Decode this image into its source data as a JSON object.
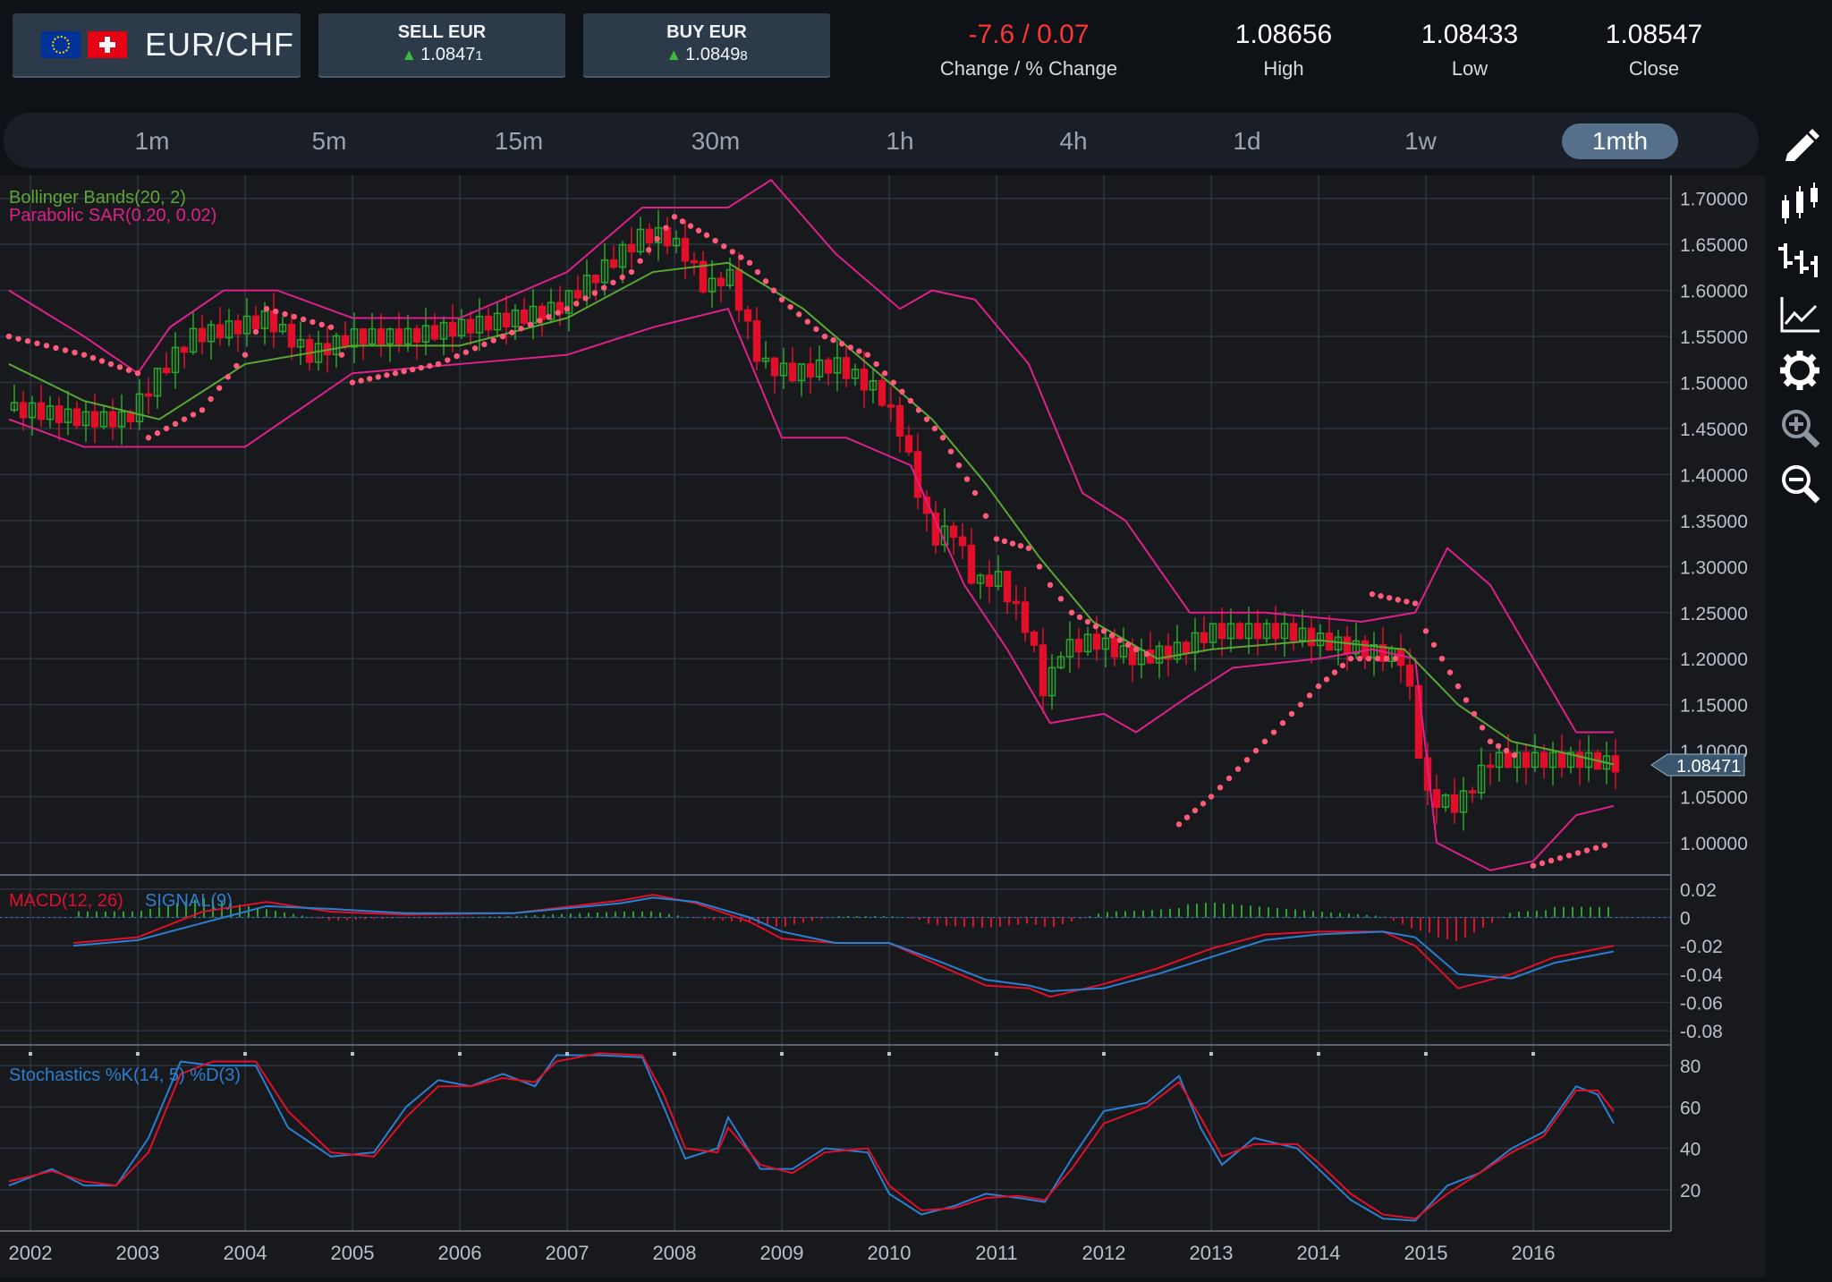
{
  "header": {
    "pair": "EUR/CHF",
    "base_flag": "eu-flag",
    "quote_flag": "ch-flag",
    "sell": {
      "label": "SELL EUR",
      "price_main": "1.0847",
      "price_small": "1"
    },
    "buy": {
      "label": "BUY EUR",
      "price_main": "1.0849",
      "price_small": "8"
    },
    "change": {
      "value": "-7.6 / 0.07",
      "label": "Change / % Change"
    },
    "high": {
      "value": "1.08656",
      "label": "High"
    },
    "low": {
      "value": "1.08433",
      "label": "Low"
    },
    "close": {
      "value": "1.08547",
      "label": "Close"
    }
  },
  "timeframes": [
    "1m",
    "5m",
    "15m",
    "30m",
    "1h",
    "4h",
    "1d",
    "1w",
    "1mth"
  ],
  "active_timeframe": "1mth",
  "side_tools": [
    "pencil-icon",
    "candlestick-icon",
    "ohlc-bar-icon",
    "line-chart-icon",
    "settings-icon",
    "zoom-in-icon",
    "zoom-out-icon"
  ],
  "colors": {
    "up": "#28a628",
    "down": "#e0102a",
    "bollinger_mid": "#5aa832",
    "bollinger_band": "#e0208a",
    "sar": "#ff5a7a",
    "macd": "#e0102a",
    "signal": "#2a7fd0",
    "accent": "#56708c"
  },
  "indicators": {
    "bollinger": "Bollinger Bands(20, 2)",
    "sar": "Parabolic SAR(0.20, 0.02)",
    "macd": "MACD(12, 26)",
    "signal": "SIGNAL(9)",
    "stoch": "Stochastics %K(14, 5) %D(3)"
  },
  "last_price_tag": "1.08471",
  "chart_data": {
    "type": "candlestick",
    "price_axis": {
      "ylim": [
        0.965,
        1.725
      ],
      "ticks": [
        "1.70000",
        "1.65000",
        "1.60000",
        "1.55000",
        "1.50000",
        "1.45000",
        "1.40000",
        "1.35000",
        "1.30000",
        "1.25000",
        "1.20000",
        "1.15000",
        "1.10000",
        "1.05000",
        "1.00000"
      ]
    },
    "macd_axis": {
      "ylim": [
        -0.09,
        0.03
      ],
      "ticks": [
        "0.02",
        "0",
        "-0.02",
        "-0.04",
        "-0.06",
        "-0.08"
      ]
    },
    "stoch_axis": {
      "ylim": [
        0,
        90
      ],
      "ticks": [
        "80",
        "60",
        "40",
        "20"
      ]
    },
    "x_years": [
      "2002",
      "2003",
      "2004",
      "2005",
      "2006",
      "2007",
      "2008",
      "2009",
      "2010",
      "2011",
      "2012",
      "2013",
      "2014",
      "2015",
      "2016"
    ],
    "close_points": [
      [
        2001.8,
        1.47
      ],
      [
        2002.0,
        1.47
      ],
      [
        2002.5,
        1.46
      ],
      [
        2002.9,
        1.46
      ],
      [
        2003.2,
        1.51
      ],
      [
        2003.5,
        1.55
      ],
      [
        2003.9,
        1.56
      ],
      [
        2004.2,
        1.57
      ],
      [
        2004.6,
        1.53
      ],
      [
        2005.0,
        1.55
      ],
      [
        2005.5,
        1.55
      ],
      [
        2006.0,
        1.56
      ],
      [
        2006.5,
        1.57
      ],
      [
        2006.9,
        1.58
      ],
      [
        2007.3,
        1.62
      ],
      [
        2007.7,
        1.66
      ],
      [
        2007.9,
        1.66
      ],
      [
        2008.1,
        1.64
      ],
      [
        2008.3,
        1.6
      ],
      [
        2008.5,
        1.62
      ],
      [
        2008.8,
        1.52
      ],
      [
        2009.1,
        1.51
      ],
      [
        2009.5,
        1.52
      ],
      [
        2009.9,
        1.49
      ],
      [
        2010.1,
        1.45
      ],
      [
        2010.4,
        1.33
      ],
      [
        2010.6,
        1.34
      ],
      [
        2010.8,
        1.28
      ],
      [
        2011.0,
        1.29
      ],
      [
        2011.3,
        1.23
      ],
      [
        2011.45,
        1.16
      ],
      [
        2011.6,
        1.21
      ],
      [
        2011.9,
        1.22
      ],
      [
        2012.3,
        1.2
      ],
      [
        2012.7,
        1.21
      ],
      [
        2013.0,
        1.23
      ],
      [
        2013.3,
        1.23
      ],
      [
        2013.7,
        1.23
      ],
      [
        2014.0,
        1.22
      ],
      [
        2014.4,
        1.21
      ],
      [
        2014.8,
        1.2
      ],
      [
        2015.0,
        1.05
      ],
      [
        2015.3,
        1.04
      ],
      [
        2015.6,
        1.09
      ],
      [
        2015.9,
        1.09
      ],
      [
        2016.2,
        1.09
      ],
      [
        2016.5,
        1.09
      ],
      [
        2016.75,
        1.085
      ]
    ],
    "bollinger": {
      "upper": [
        [
          2001.8,
          1.6
        ],
        [
          2002.5,
          1.55
        ],
        [
          2003.0,
          1.51
        ],
        [
          2003.3,
          1.56
        ],
        [
          2003.8,
          1.6
        ],
        [
          2004.3,
          1.6
        ],
        [
          2005.0,
          1.57
        ],
        [
          2006.0,
          1.57
        ],
        [
          2007.0,
          1.62
        ],
        [
          2007.7,
          1.69
        ],
        [
          2008.5,
          1.69
        ],
        [
          2008.9,
          1.72
        ],
        [
          2009.5,
          1.64
        ],
        [
          2010.1,
          1.58
        ],
        [
          2010.4,
          1.6
        ],
        [
          2010.8,
          1.59
        ],
        [
          2011.3,
          1.52
        ],
        [
          2011.8,
          1.38
        ],
        [
          2012.2,
          1.35
        ],
        [
          2012.8,
          1.25
        ],
        [
          2013.5,
          1.25
        ],
        [
          2014.4,
          1.24
        ],
        [
          2014.9,
          1.25
        ],
        [
          2015.2,
          1.32
        ],
        [
          2015.6,
          1.28
        ],
        [
          2016.0,
          1.2
        ],
        [
          2016.4,
          1.12
        ],
        [
          2016.75,
          1.12
        ]
      ],
      "middle": [
        [
          2001.8,
          1.52
        ],
        [
          2002.5,
          1.48
        ],
        [
          2003.2,
          1.46
        ],
        [
          2004.0,
          1.52
        ],
        [
          2005.0,
          1.54
        ],
        [
          2006.0,
          1.54
        ],
        [
          2007.0,
          1.57
        ],
        [
          2007.8,
          1.62
        ],
        [
          2008.5,
          1.63
        ],
        [
          2009.2,
          1.58
        ],
        [
          2009.9,
          1.51
        ],
        [
          2010.4,
          1.46
        ],
        [
          2010.9,
          1.39
        ],
        [
          2011.4,
          1.31
        ],
        [
          2011.9,
          1.24
        ],
        [
          2012.5,
          1.2
        ],
        [
          2013.0,
          1.21
        ],
        [
          2014.0,
          1.22
        ],
        [
          2014.8,
          1.21
        ],
        [
          2015.3,
          1.15
        ],
        [
          2015.8,
          1.11
        ],
        [
          2016.2,
          1.1
        ],
        [
          2016.75,
          1.085
        ]
      ],
      "lower": [
        [
          2001.8,
          1.46
        ],
        [
          2002.5,
          1.43
        ],
        [
          2003.3,
          1.43
        ],
        [
          2004.0,
          1.43
        ],
        [
          2004.5,
          1.47
        ],
        [
          2005.0,
          1.51
        ],
        [
          2006.0,
          1.52
        ],
        [
          2007.0,
          1.53
        ],
        [
          2007.8,
          1.56
        ],
        [
          2008.5,
          1.58
        ],
        [
          2009.0,
          1.44
        ],
        [
          2009.6,
          1.44
        ],
        [
          2010.2,
          1.41
        ],
        [
          2010.7,
          1.28
        ],
        [
          2011.1,
          1.21
        ],
        [
          2011.5,
          1.13
        ],
        [
          2012.0,
          1.14
        ],
        [
          2012.3,
          1.12
        ],
        [
          2012.8,
          1.16
        ],
        [
          2013.2,
          1.19
        ],
        [
          2014.0,
          1.2
        ],
        [
          2014.5,
          1.21
        ],
        [
          2014.9,
          1.2
        ],
        [
          2015.1,
          1.0
        ],
        [
          2015.6,
          0.97
        ],
        [
          2016.0,
          0.98
        ],
        [
          2016.4,
          1.03
        ],
        [
          2016.75,
          1.04
        ]
      ]
    },
    "sar": [
      [
        2001.8,
        1.55
      ],
      [
        2002.5,
        1.53
      ],
      [
        2003.0,
        1.51
      ],
      [
        2003.1,
        1.44
      ],
      [
        2003.6,
        1.47
      ],
      [
        2004.0,
        1.53
      ],
      [
        2004.2,
        1.58
      ],
      [
        2004.8,
        1.56
      ],
      [
        2005.0,
        1.5
      ],
      [
        2005.8,
        1.52
      ],
      [
        2006.4,
        1.55
      ],
      [
        2007.0,
        1.58
      ],
      [
        2007.6,
        1.62
      ],
      [
        2008.0,
        1.68
      ],
      [
        2008.3,
        1.66
      ],
      [
        2008.7,
        1.63
      ],
      [
        2009.0,
        1.59
      ],
      [
        2009.4,
        1.55
      ],
      [
        2009.8,
        1.53
      ],
      [
        2010.2,
        1.48
      ],
      [
        2010.5,
        1.44
      ],
      [
        2010.8,
        1.38
      ],
      [
        2011.0,
        1.33
      ],
      [
        2011.3,
        1.32
      ],
      [
        2011.5,
        1.28
      ],
      [
        2011.7,
        1.25
      ],
      [
        2012.0,
        1.23
      ],
      [
        2012.3,
        1.21
      ],
      [
        2012.5,
        1.2
      ],
      [
        2012.7,
        1.02
      ],
      [
        2013.0,
        1.05
      ],
      [
        2013.5,
        1.11
      ],
      [
        2014.0,
        1.17
      ],
      [
        2014.3,
        1.2
      ],
      [
        2014.8,
        1.2
      ],
      [
        2014.5,
        1.27
      ],
      [
        2014.9,
        1.26
      ],
      [
        2015.0,
        1.23
      ],
      [
        2015.3,
        1.17
      ],
      [
        2015.6,
        1.11
      ],
      [
        2015.9,
        1.09
      ],
      [
        2016.0,
        0.975
      ],
      [
        2016.75,
        1.0
      ]
    ],
    "macd": [
      [
        2002.4,
        -0.018
      ],
      [
        2003.0,
        -0.014
      ],
      [
        2003.6,
        0.004
      ],
      [
        2004.2,
        0.011
      ],
      [
        2004.8,
        0.004
      ],
      [
        2005.5,
        0.002
      ],
      [
        2006.5,
        0.003
      ],
      [
        2007.5,
        0.012
      ],
      [
        2007.8,
        0.016
      ],
      [
        2008.2,
        0.01
      ],
      [
        2008.7,
        -0.003
      ],
      [
        2009.0,
        -0.015
      ],
      [
        2009.5,
        -0.018
      ],
      [
        2010.0,
        -0.018
      ],
      [
        2010.5,
        -0.035
      ],
      [
        2010.9,
        -0.048
      ],
      [
        2011.3,
        -0.05
      ],
      [
        2011.5,
        -0.056
      ],
      [
        2012.0,
        -0.047
      ],
      [
        2012.5,
        -0.036
      ],
      [
        2013.0,
        -0.022
      ],
      [
        2013.5,
        -0.012
      ],
      [
        2014.0,
        -0.01
      ],
      [
        2014.6,
        -0.01
      ],
      [
        2014.9,
        -0.02
      ],
      [
        2015.3,
        -0.05
      ],
      [
        2015.8,
        -0.04
      ],
      [
        2016.2,
        -0.028
      ],
      [
        2016.75,
        -0.02
      ]
    ],
    "signal": [
      [
        2002.4,
        -0.02
      ],
      [
        2003.0,
        -0.016
      ],
      [
        2003.6,
        -0.004
      ],
      [
        2004.2,
        0.008
      ],
      [
        2004.8,
        0.006
      ],
      [
        2005.5,
        0.003
      ],
      [
        2006.5,
        0.003
      ],
      [
        2007.5,
        0.01
      ],
      [
        2007.8,
        0.014
      ],
      [
        2008.2,
        0.011
      ],
      [
        2008.7,
        0.0
      ],
      [
        2009.0,
        -0.01
      ],
      [
        2009.5,
        -0.018
      ],
      [
        2010.0,
        -0.018
      ],
      [
        2010.5,
        -0.032
      ],
      [
        2010.9,
        -0.044
      ],
      [
        2011.3,
        -0.048
      ],
      [
        2011.5,
        -0.052
      ],
      [
        2012.0,
        -0.05
      ],
      [
        2012.5,
        -0.04
      ],
      [
        2013.0,
        -0.028
      ],
      [
        2013.5,
        -0.016
      ],
      [
        2014.0,
        -0.012
      ],
      [
        2014.6,
        -0.01
      ],
      [
        2014.9,
        -0.014
      ],
      [
        2015.3,
        -0.04
      ],
      [
        2015.8,
        -0.043
      ],
      [
        2016.2,
        -0.032
      ],
      [
        2016.75,
        -0.024
      ]
    ],
    "stoch_k": [
      [
        2001.8,
        22
      ],
      [
        2002.2,
        30
      ],
      [
        2002.5,
        22
      ],
      [
        2002.8,
        22
      ],
      [
        2003.1,
        45
      ],
      [
        2003.4,
        82
      ],
      [
        2003.7,
        80
      ],
      [
        2004.1,
        80
      ],
      [
        2004.4,
        50
      ],
      [
        2004.8,
        36
      ],
      [
        2005.2,
        38
      ],
      [
        2005.5,
        60
      ],
      [
        2005.8,
        73
      ],
      [
        2006.1,
        70
      ],
      [
        2006.4,
        76
      ],
      [
        2006.7,
        70
      ],
      [
        2006.9,
        85
      ],
      [
        2007.3,
        85
      ],
      [
        2007.7,
        84
      ],
      [
        2007.9,
        60
      ],
      [
        2008.1,
        35
      ],
      [
        2008.4,
        40
      ],
      [
        2008.5,
        55
      ],
      [
        2008.8,
        30
      ],
      [
        2009.1,
        30
      ],
      [
        2009.4,
        40
      ],
      [
        2009.8,
        38
      ],
      [
        2010.0,
        18
      ],
      [
        2010.3,
        8
      ],
      [
        2010.6,
        12
      ],
      [
        2010.9,
        18
      ],
      [
        2011.2,
        16
      ],
      [
        2011.45,
        14
      ],
      [
        2011.7,
        35
      ],
      [
        2012.0,
        58
      ],
      [
        2012.4,
        62
      ],
      [
        2012.7,
        75
      ],
      [
        2012.9,
        50
      ],
      [
        2013.1,
        32
      ],
      [
        2013.4,
        45
      ],
      [
        2013.8,
        40
      ],
      [
        2014.0,
        30
      ],
      [
        2014.3,
        15
      ],
      [
        2014.6,
        6
      ],
      [
        2014.9,
        5
      ],
      [
        2015.2,
        22
      ],
      [
        2015.5,
        28
      ],
      [
        2015.8,
        40
      ],
      [
        2016.1,
        48
      ],
      [
        2016.4,
        70
      ],
      [
        2016.6,
        66
      ],
      [
        2016.75,
        52
      ]
    ],
    "stoch_d": [
      [
        2001.8,
        24
      ],
      [
        2002.2,
        29
      ],
      [
        2002.5,
        24
      ],
      [
        2002.8,
        22
      ],
      [
        2003.1,
        38
      ],
      [
        2003.4,
        76
      ],
      [
        2003.7,
        82
      ],
      [
        2004.1,
        82
      ],
      [
        2004.4,
        58
      ],
      [
        2004.8,
        38
      ],
      [
        2005.2,
        36
      ],
      [
        2005.5,
        55
      ],
      [
        2005.8,
        70
      ],
      [
        2006.1,
        70
      ],
      [
        2006.4,
        74
      ],
      [
        2006.7,
        72
      ],
      [
        2006.9,
        82
      ],
      [
        2007.3,
        86
      ],
      [
        2007.7,
        85
      ],
      [
        2007.9,
        66
      ],
      [
        2008.1,
        40
      ],
      [
        2008.4,
        38
      ],
      [
        2008.5,
        50
      ],
      [
        2008.8,
        32
      ],
      [
        2009.1,
        28
      ],
      [
        2009.4,
        38
      ],
      [
        2009.8,
        40
      ],
      [
        2010.0,
        22
      ],
      [
        2010.3,
        10
      ],
      [
        2010.6,
        11
      ],
      [
        2010.9,
        16
      ],
      [
        2011.2,
        17
      ],
      [
        2011.45,
        15
      ],
      [
        2011.7,
        30
      ],
      [
        2012.0,
        52
      ],
      [
        2012.4,
        60
      ],
      [
        2012.7,
        72
      ],
      [
        2012.9,
        55
      ],
      [
        2013.1,
        36
      ],
      [
        2013.4,
        42
      ],
      [
        2013.8,
        42
      ],
      [
        2014.0,
        33
      ],
      [
        2014.3,
        18
      ],
      [
        2014.6,
        8
      ],
      [
        2014.9,
        6
      ],
      [
        2015.2,
        18
      ],
      [
        2015.5,
        28
      ],
      [
        2015.8,
        38
      ],
      [
        2016.1,
        46
      ],
      [
        2016.4,
        68
      ],
      [
        2016.6,
        68
      ],
      [
        2016.75,
        58
      ]
    ],
    "grid": true
  }
}
